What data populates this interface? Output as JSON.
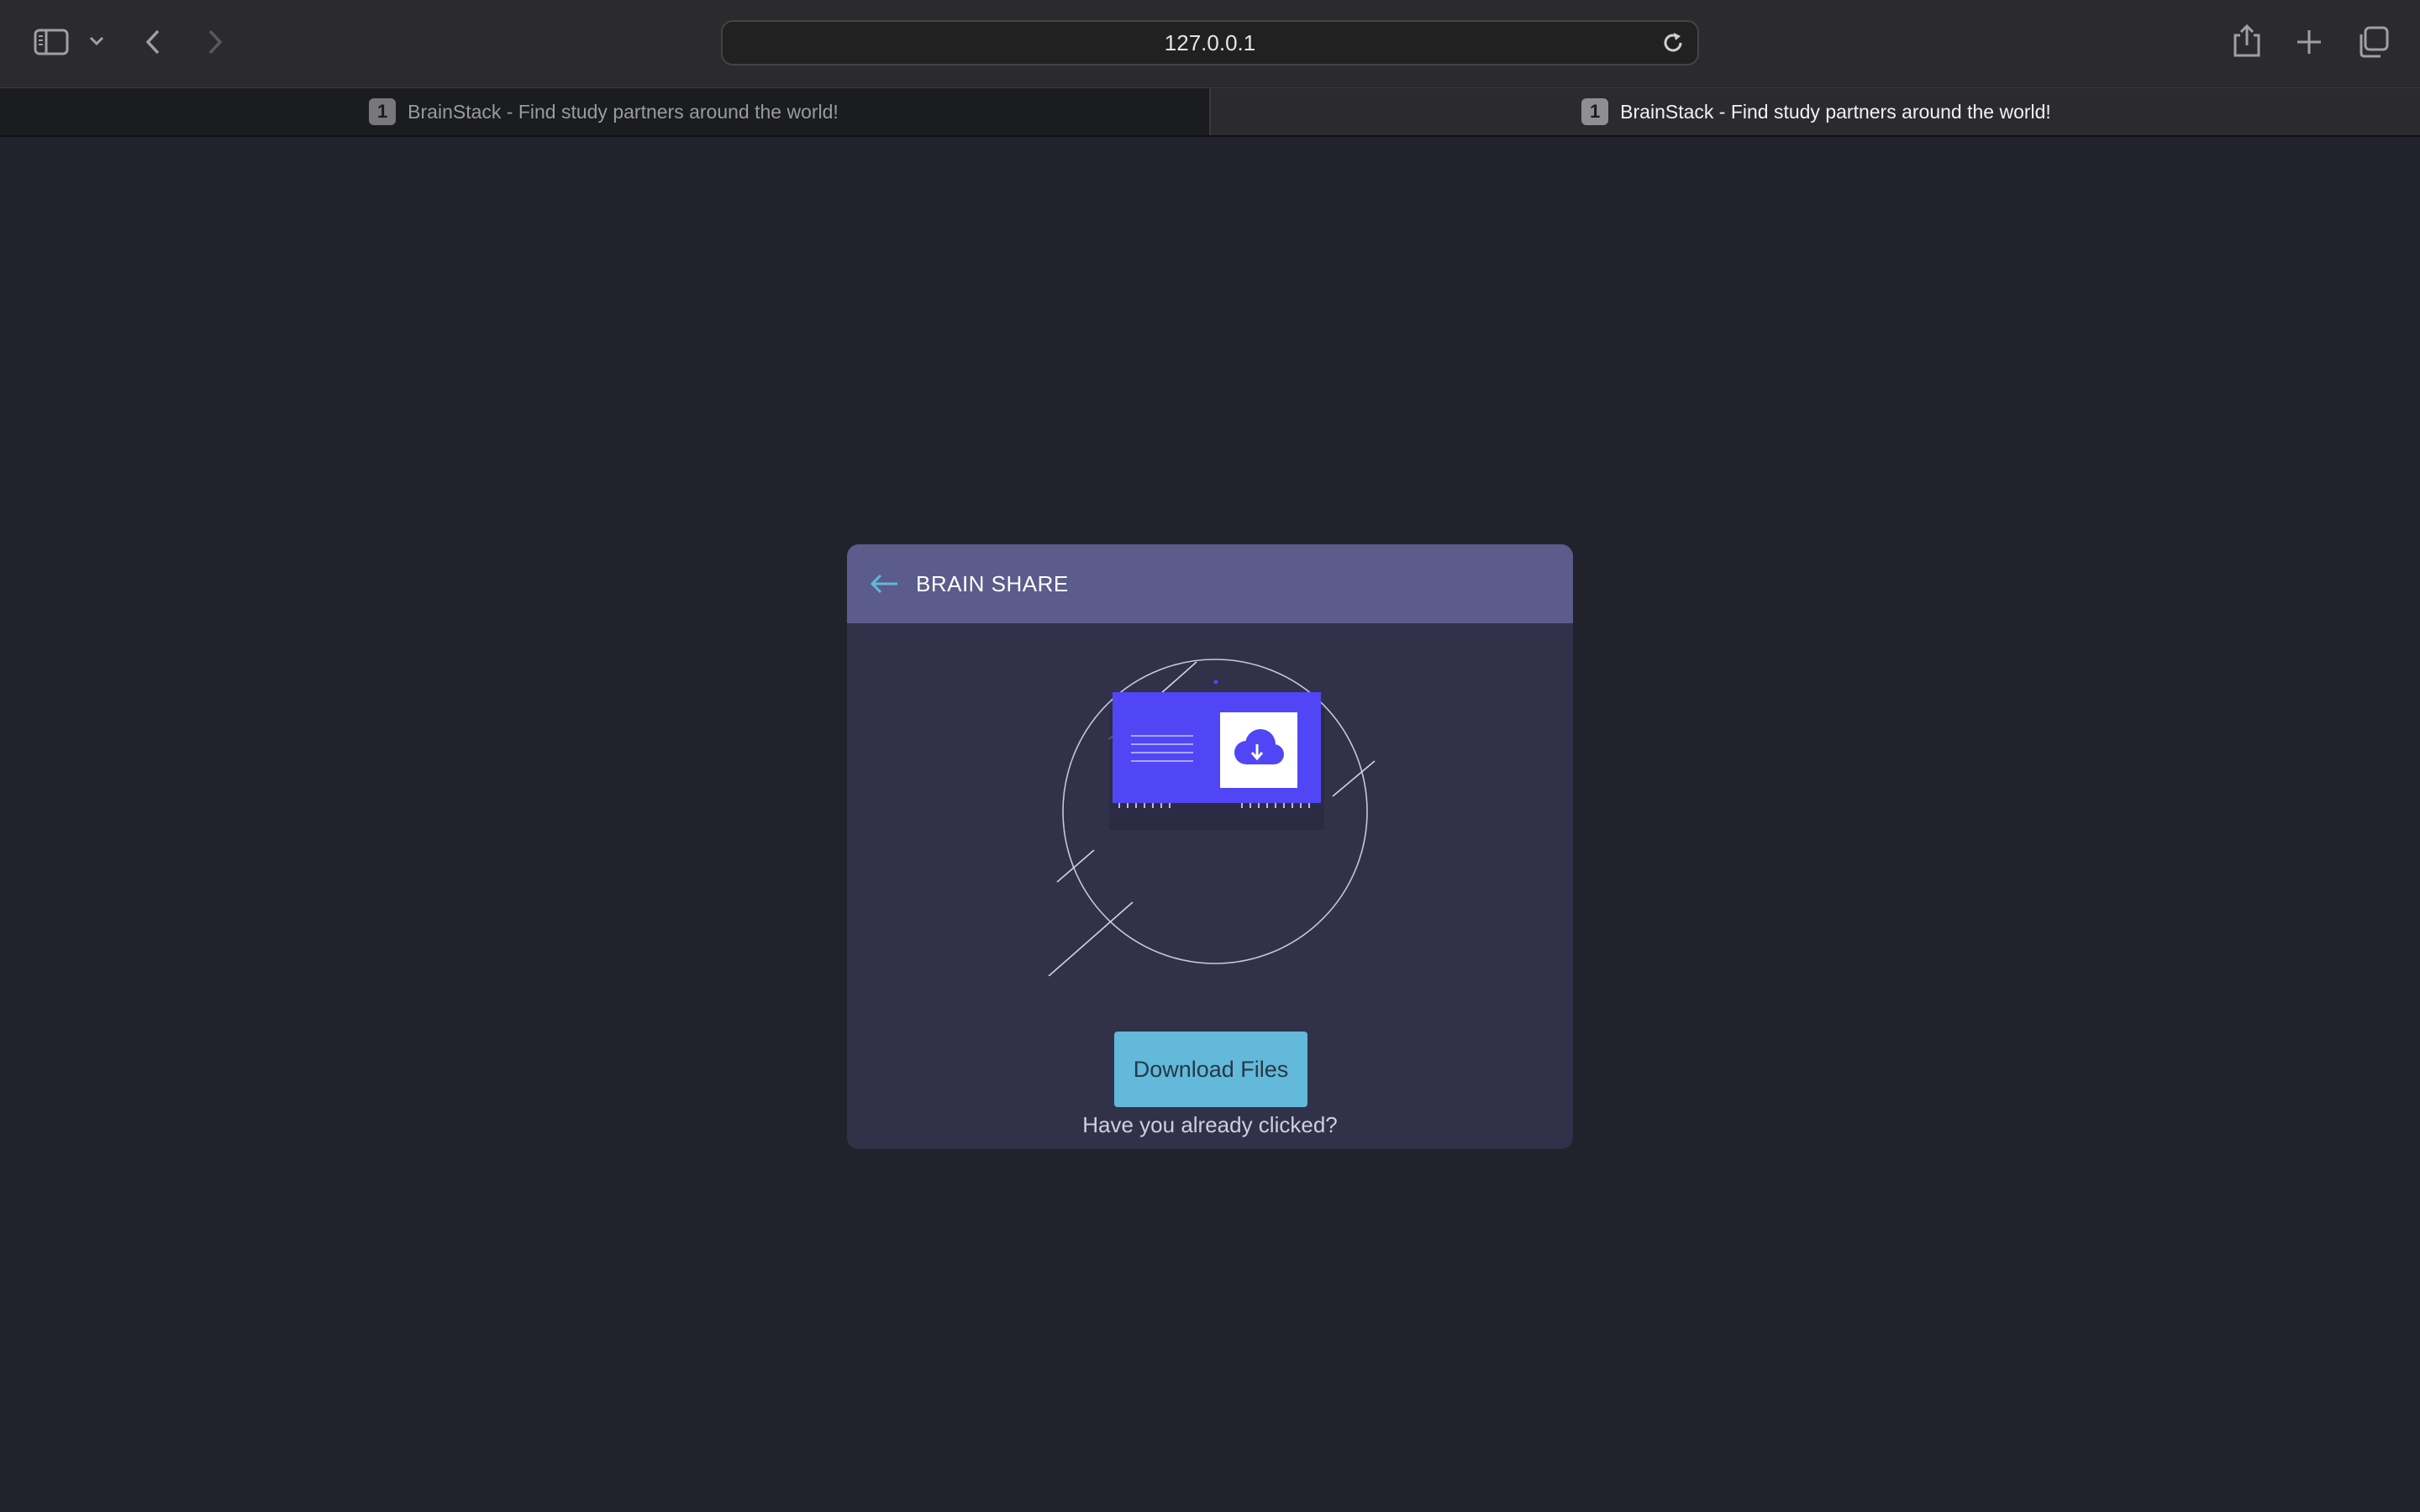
{
  "browser": {
    "url": "127.0.0.1",
    "tabs": [
      {
        "badge": "1",
        "title": "BrainStack - Find study partners around the world!",
        "active": false
      },
      {
        "badge": "1",
        "title": "BrainStack - Find study partners around the world!",
        "active": true
      }
    ],
    "icons": {
      "sidebar": "sidebar-icon",
      "dropdown": "chevron-down-icon",
      "back": "chevron-left-icon",
      "forward": "chevron-right-icon",
      "reload": "reload-icon",
      "share": "share-icon",
      "new_tab": "plus-icon",
      "tab_overview": "tabs-overview-icon"
    }
  },
  "page": {
    "header_title": "BRAIN SHARE",
    "download_button": "Download Files",
    "clicked_question": "Have you already clicked?",
    "colors": {
      "background": "#22222c",
      "card": "#31314a",
      "header": "#5b5b8c",
      "accent": "#62b9d9",
      "illustration": "#5146f5"
    }
  }
}
